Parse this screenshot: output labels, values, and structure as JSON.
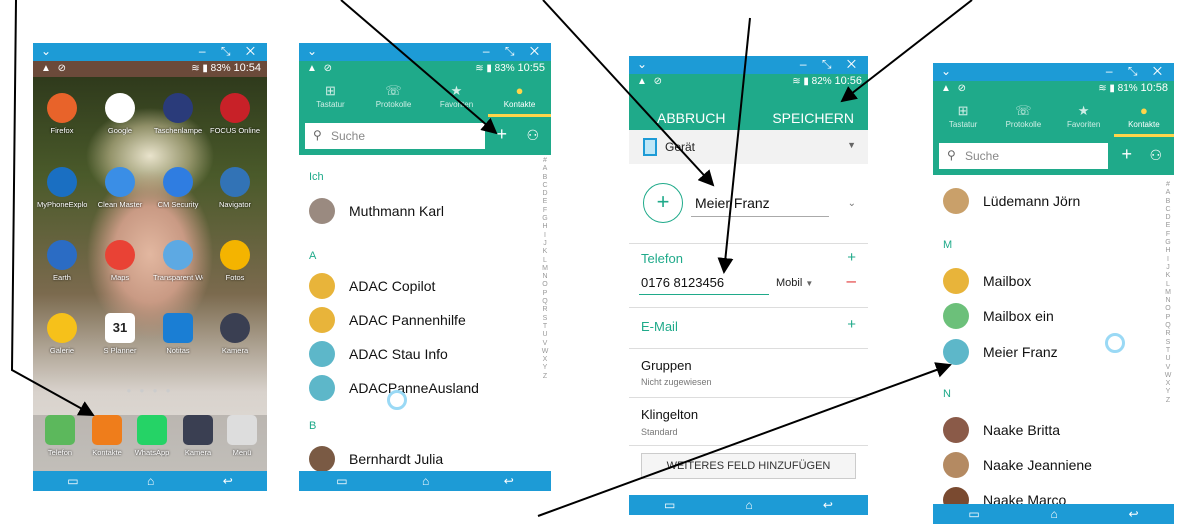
{
  "status": {
    "s1_battery": "83%",
    "s1_time": "10:54",
    "s2_battery": "83%",
    "s2_time": "10:55",
    "s3_battery": "82%",
    "s3_time": "10:56",
    "s4_battery": "81%",
    "s4_time": "10:58"
  },
  "home": {
    "apps": [
      {
        "label": "Firefox",
        "icon": "firefox-icon",
        "color": "#e8632a"
      },
      {
        "label": "Google",
        "icon": "google-icon",
        "color": "#ffffff"
      },
      {
        "label": "Taschenlampe",
        "icon": "flashlight-icon",
        "color": "#2a3b7a"
      },
      {
        "label": "FOCUS Online",
        "icon": "focus-icon",
        "color": "#c82128"
      },
      {
        "label": "MyPhoneExplorer Client",
        "icon": "sync-icon",
        "color": "#1a6fc2"
      },
      {
        "label": "Clean Master",
        "icon": "broom-icon",
        "color": "#3a8ee6"
      },
      {
        "label": "CM Security",
        "icon": "shield-icon",
        "color": "#2f7de1"
      },
      {
        "label": "Navigator",
        "icon": "navigator-icon",
        "color": "#3273b6"
      },
      {
        "label": "Earth",
        "icon": "earth-icon",
        "color": "#2b6cc4"
      },
      {
        "label": "Maps",
        "icon": "maps-icon",
        "color": "#e94235"
      },
      {
        "label": "Transparent Weather",
        "icon": "weather-icon",
        "color": "#5da9e3"
      },
      {
        "label": "Fotos",
        "icon": "pinwheel-icon",
        "color": "#f4b400"
      },
      {
        "label": "Galerie",
        "icon": "gallery-icon",
        "color": "#f6c11a"
      },
      {
        "label": "S Planner",
        "icon": "calendar-icon",
        "color": "#ffffff"
      },
      {
        "label": "Notitas",
        "icon": "notes-icon",
        "color": "#1a7ed4"
      },
      {
        "label": "Kamera",
        "icon": "camera-icon",
        "color": "#3a3f52"
      }
    ],
    "calendar_day": "31",
    "dock": [
      {
        "label": "Telefon",
        "icon": "phone-icon",
        "color": "#5cb85c"
      },
      {
        "label": "Kontakte",
        "icon": "contacts-icon",
        "color": "#ef7d1b"
      },
      {
        "label": "WhatsApp",
        "icon": "whatsapp-icon",
        "color": "#25d366"
      },
      {
        "label": "Kamera",
        "icon": "camera-icon",
        "color": "#3a3f52"
      },
      {
        "label": "Menü",
        "icon": "apps-grid-icon",
        "color": "#dddddd"
      }
    ]
  },
  "tabs": [
    {
      "label": "Tastatur",
      "icon": "keypad-icon"
    },
    {
      "label": "Protokolle",
      "icon": "call-log-icon"
    },
    {
      "label": "Favoriten",
      "icon": "star-icon"
    },
    {
      "label": "Kontakte",
      "icon": "person-icon"
    }
  ],
  "search": {
    "placeholder": "Suche"
  },
  "contacts1": {
    "sections": [
      "Ich",
      "A",
      "B"
    ],
    "me": "Muthmann Karl",
    "a_items": [
      "ADAC Copilot",
      "ADAC Pannenhilfe",
      "ADAC Stau Info",
      "ADACPanneAusland"
    ],
    "b_items": [
      "Bernhardt Julia"
    ]
  },
  "edit": {
    "cancel": "ABBRUCH",
    "save": "SPEICHERN",
    "account": "Gerät",
    "name": "Meier Franz",
    "phone_label": "Telefon",
    "phone_value": "0176 8123456",
    "phone_type": "Mobil",
    "email_label": "E-Mail",
    "groups_label": "Gruppen",
    "groups_value": "Nicht zugewiesen",
    "ringtone_label": "Klingelton",
    "ringtone_value": "Standard",
    "add_field": "WEITERES FELD HINZUFÜGEN"
  },
  "contacts2": {
    "top": "Lüdemann Jörn",
    "sections": [
      "M",
      "N"
    ],
    "m_items": [
      "Mailbox",
      "Mailbox ein",
      "Meier Franz"
    ],
    "n_items": [
      "Naake Britta",
      "Naake Jeanniene",
      "Naake Marco"
    ]
  },
  "alphabet": [
    "#",
    "A",
    "B",
    "C",
    "D",
    "E",
    "F",
    "G",
    "H",
    "I",
    "J",
    "K",
    "L",
    "M",
    "N",
    "O",
    "P",
    "Q",
    "R",
    "S",
    "T",
    "U",
    "V",
    "W",
    "X",
    "Y",
    "Z"
  ],
  "colors": {
    "accent": "#1faa8a",
    "titlebar": "#1d9bd6",
    "avatar_yellow": "#e8b43a",
    "avatar_teal": "#5db7c9",
    "avatar_green": "#6cc07a"
  }
}
